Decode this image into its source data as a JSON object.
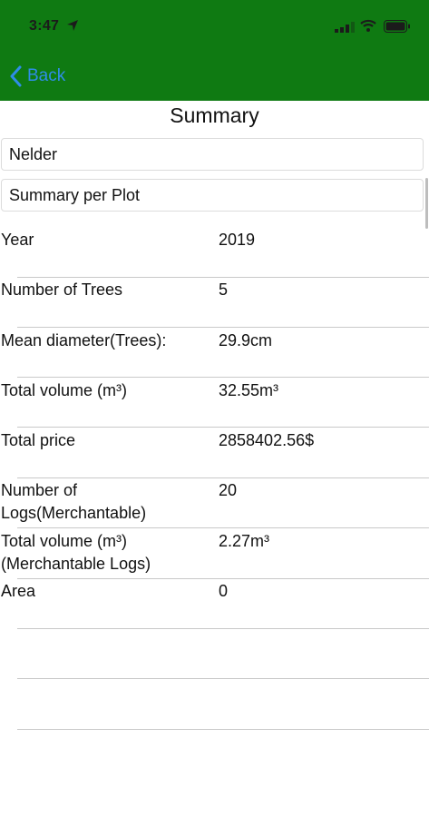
{
  "status_bar": {
    "time": "3:47"
  },
  "nav": {
    "back_label": "Back"
  },
  "title": "Summary",
  "fields": {
    "project": "Nelder",
    "mode": "Summary per Plot"
  },
  "rows": [
    {
      "label": "Year",
      "value": "2019"
    },
    {
      "label": "Number of Trees",
      "value": "5"
    },
    {
      "label": "Mean diameter(Trees):",
      "value": "29.9cm"
    },
    {
      "label": "Total volume (m³)",
      "value": "32.55m³"
    },
    {
      "label": "Total price",
      "value": "2858402.56$"
    },
    {
      "label_line1": "Number of",
      "label_line2": "Logs(Merchantable)",
      "value": "20"
    },
    {
      "label_line1": "Total volume (m³)",
      "label_line2": "(Merchantable Logs)",
      "value": "2.27m³"
    },
    {
      "label": "Area",
      "value": "0"
    }
  ],
  "colors": {
    "header_bg": "#0f7a12",
    "back_blue": "#2f8de8",
    "separator": "#c9c9c9"
  }
}
